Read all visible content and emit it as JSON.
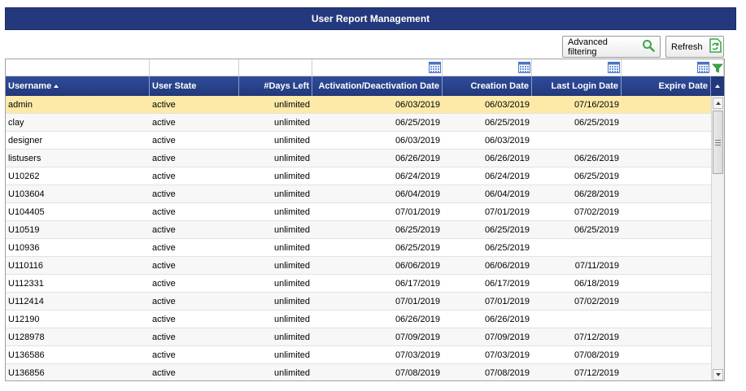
{
  "title": "User Report Management",
  "toolbar": {
    "advanced_filtering_label": "Advanced filtering",
    "refresh_label": "Refresh"
  },
  "colors": {
    "header_bar": "#24397d",
    "selected_row": "#fdeaa9",
    "refresh_icon": "#3aa64a",
    "search_icon": "#3aa64a"
  },
  "icons": {
    "calendar": "calendar-icon",
    "filter": "filter-icon",
    "search": "search-icon",
    "refresh": "refresh-icon"
  },
  "columns": [
    {
      "label": "Username",
      "sorted": "ascending"
    },
    {
      "label": "User State"
    },
    {
      "label": "#Days Left"
    },
    {
      "label": "Activation/Deactivation Date"
    },
    {
      "label": "Creation Date"
    },
    {
      "label": "Last Login Date"
    },
    {
      "label": "Expire Date"
    }
  ],
  "rows": [
    {
      "username": "admin",
      "state": "active",
      "days_left": "unlimited",
      "activation": "06/03/2019",
      "creation": "06/03/2019",
      "last_login": "07/16/2019",
      "expire": ""
    },
    {
      "username": "clay",
      "state": "active",
      "days_left": "unlimited",
      "activation": "06/25/2019",
      "creation": "06/25/2019",
      "last_login": "06/25/2019",
      "expire": ""
    },
    {
      "username": "designer",
      "state": "active",
      "days_left": "unlimited",
      "activation": "06/03/2019",
      "creation": "06/03/2019",
      "last_login": "",
      "expire": ""
    },
    {
      "username": "listusers",
      "state": "active",
      "days_left": "unlimited",
      "activation": "06/26/2019",
      "creation": "06/26/2019",
      "last_login": "06/26/2019",
      "expire": ""
    },
    {
      "username": "U10262",
      "state": "active",
      "days_left": "unlimited",
      "activation": "06/24/2019",
      "creation": "06/24/2019",
      "last_login": "06/25/2019",
      "expire": ""
    },
    {
      "username": "U103604",
      "state": "active",
      "days_left": "unlimited",
      "activation": "06/04/2019",
      "creation": "06/04/2019",
      "last_login": "06/28/2019",
      "expire": ""
    },
    {
      "username": "U104405",
      "state": "active",
      "days_left": "unlimited",
      "activation": "07/01/2019",
      "creation": "07/01/2019",
      "last_login": "07/02/2019",
      "expire": ""
    },
    {
      "username": "U10519",
      "state": "active",
      "days_left": "unlimited",
      "activation": "06/25/2019",
      "creation": "06/25/2019",
      "last_login": "06/25/2019",
      "expire": ""
    },
    {
      "username": "U10936",
      "state": "active",
      "days_left": "unlimited",
      "activation": "06/25/2019",
      "creation": "06/25/2019",
      "last_login": "",
      "expire": ""
    },
    {
      "username": "U110116",
      "state": "active",
      "days_left": "unlimited",
      "activation": "06/06/2019",
      "creation": "06/06/2019",
      "last_login": "07/11/2019",
      "expire": ""
    },
    {
      "username": "U112331",
      "state": "active",
      "days_left": "unlimited",
      "activation": "06/17/2019",
      "creation": "06/17/2019",
      "last_login": "06/18/2019",
      "expire": ""
    },
    {
      "username": "U112414",
      "state": "active",
      "days_left": "unlimited",
      "activation": "07/01/2019",
      "creation": "07/01/2019",
      "last_login": "07/02/2019",
      "expire": ""
    },
    {
      "username": "U12190",
      "state": "active",
      "days_left": "unlimited",
      "activation": "06/26/2019",
      "creation": "06/26/2019",
      "last_login": "",
      "expire": ""
    },
    {
      "username": "U128978",
      "state": "active",
      "days_left": "unlimited",
      "activation": "07/09/2019",
      "creation": "07/09/2019",
      "last_login": "07/12/2019",
      "expire": ""
    },
    {
      "username": "U136586",
      "state": "active",
      "days_left": "unlimited",
      "activation": "07/03/2019",
      "creation": "07/03/2019",
      "last_login": "07/08/2019",
      "expire": ""
    },
    {
      "username": "U136856",
      "state": "active",
      "days_left": "unlimited",
      "activation": "07/08/2019",
      "creation": "07/08/2019",
      "last_login": "07/12/2019",
      "expire": ""
    }
  ],
  "selected_row_index": 0
}
